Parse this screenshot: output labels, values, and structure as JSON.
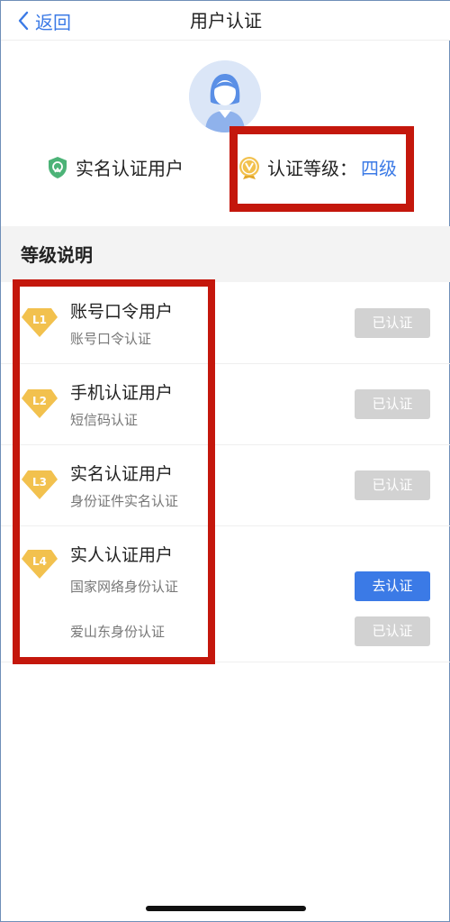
{
  "nav": {
    "back_label": "返回",
    "title": "用户认证"
  },
  "profile": {
    "verified_label": "实名认证用户",
    "level_label": "认证等级：",
    "level_value": "四级"
  },
  "section": {
    "title": "等级说明"
  },
  "levels": [
    {
      "badge": "L1",
      "title": "账号口令用户",
      "methods": [
        {
          "label": "账号口令认证",
          "button": "已认证",
          "state": "done"
        }
      ]
    },
    {
      "badge": "L2",
      "title": "手机认证用户",
      "methods": [
        {
          "label": "短信码认证",
          "button": "已认证",
          "state": "done"
        }
      ]
    },
    {
      "badge": "L3",
      "title": "实名认证用户",
      "methods": [
        {
          "label": "身份证件实名认证",
          "button": "已认证",
          "state": "done"
        }
      ]
    },
    {
      "badge": "L4",
      "title": "实人认证用户",
      "methods": [
        {
          "label": "国家网络身份认证",
          "button": "去认证",
          "state": "go"
        },
        {
          "label": "爱山东身份认证",
          "button": "已认证",
          "state": "done"
        }
      ]
    }
  ],
  "colors": {
    "accent": "#3b7ae6",
    "highlight_box": "#c4170c",
    "badge_gold": "#f2c14e",
    "button_disabled": "#d2d2d2"
  }
}
